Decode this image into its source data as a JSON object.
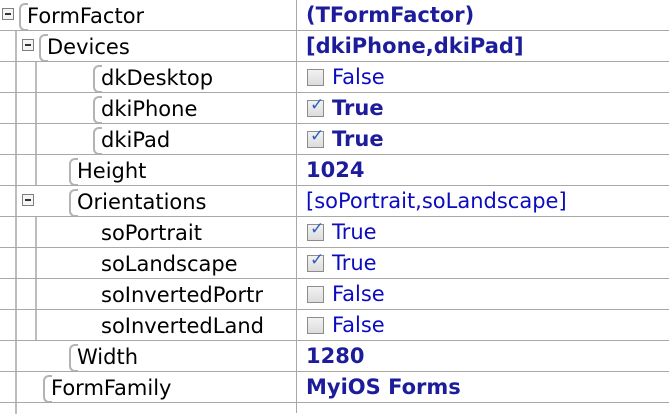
{
  "rows": [
    {
      "name": "FormFactor",
      "value": "(TFormFactor)"
    },
    {
      "name": "Devices",
      "value": "[dkiPhone,dkiPad]"
    },
    {
      "name": "dkDesktop",
      "value": "False"
    },
    {
      "name": "dkiPhone",
      "value": "True"
    },
    {
      "name": "dkiPad",
      "value": "True"
    },
    {
      "name": "Height",
      "value": "1024"
    },
    {
      "name": "Orientations",
      "value": "[soPortrait,soLandscape]"
    },
    {
      "name": "soPortrait",
      "value": "True"
    },
    {
      "name": "soLandscape",
      "value": "True"
    },
    {
      "name": "soInvertedPortr",
      "value": "False"
    },
    {
      "name": "soInvertedLand",
      "value": "False"
    },
    {
      "name": "Width",
      "value": "1280"
    },
    {
      "name": "FormFamily",
      "value": "MyiOS Forms"
    }
  ],
  "colors": {
    "value_blue": "#0b0bbf",
    "bold_blue": "#1d1d9c",
    "grid": "#a8a8a8"
  },
  "icons": {
    "expander": "collapse-minus-icon",
    "checked": "checkmark-icon"
  }
}
